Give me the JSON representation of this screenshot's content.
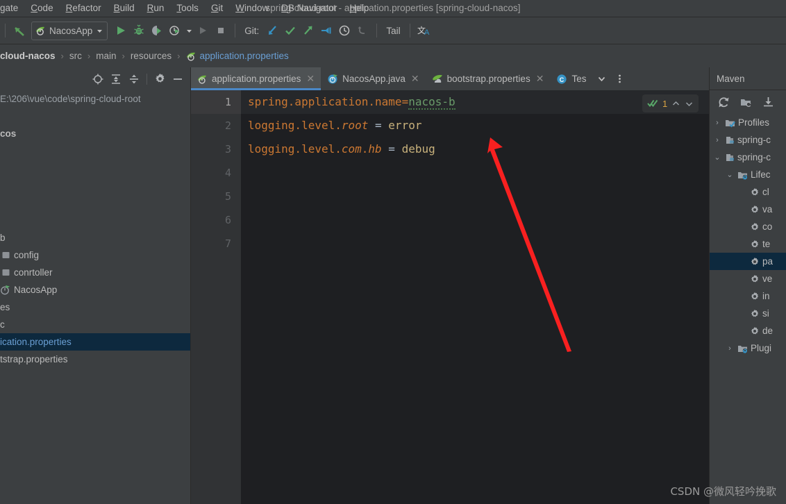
{
  "window": {
    "title": "spring-cloud-root - application.properties [spring-cloud-nacos]"
  },
  "menubar": {
    "items": [
      {
        "label": "gate"
      },
      {
        "label": "Code"
      },
      {
        "label": "Refactor"
      },
      {
        "label": "Build"
      },
      {
        "label": "Run"
      },
      {
        "label": "Tools"
      },
      {
        "label": "Git"
      },
      {
        "label": "Window"
      },
      {
        "label": "DB Navigator"
      },
      {
        "label": "Help"
      }
    ]
  },
  "toolbar": {
    "back_icon": "back-arrow-icon",
    "run_config": "NacosApp",
    "run_icon": "run-icon",
    "debug_icon": "debug-icon",
    "run_coverage_icon": "run-with-coverage-icon",
    "profile_icon": "profiler-icon",
    "rerun_icon": "rerun-icon",
    "stop_icon": "stop-icon",
    "git_label": "Git:",
    "git_update_icon": "git-update-icon",
    "git_commit_icon": "git-commit-icon",
    "git_push_icon": "git-push-icon",
    "git_branch_icon": "git-checkout-icon",
    "git_history_icon": "git-history-icon",
    "git_revert_icon": "git-revert-icon",
    "tail_label": "Tail",
    "translate_icon": "translate-icon"
  },
  "breadcrumb": {
    "items": [
      {
        "label": "cloud-nacos",
        "style": "bold"
      },
      {
        "label": "src",
        "style": "plain"
      },
      {
        "label": "main",
        "style": "plain"
      },
      {
        "label": "resources",
        "style": "plain"
      },
      {
        "label": "application.properties",
        "style": "link",
        "icon": "spring-leaf-icon"
      }
    ],
    "separator": "›"
  },
  "project_panel": {
    "header_icons": [
      "locate-icon",
      "expand-all-icon",
      "collapse-all-icon",
      "settings-gear-icon",
      "hide-icon"
    ],
    "rows": [
      {
        "label": "E:\\206\\vue\\code\\spring-cloud-root",
        "indent": 0,
        "icon": "none",
        "style": "path"
      },
      {
        "label": "",
        "indent": 0,
        "icon": "none",
        "style": "plain"
      },
      {
        "label": "cos",
        "indent": 0,
        "icon": "none",
        "style": "bold"
      },
      {
        "label": "",
        "indent": 0,
        "icon": "none",
        "style": "plain"
      },
      {
        "label": "",
        "indent": 0,
        "icon": "none",
        "style": "plain"
      },
      {
        "label": "",
        "indent": 0,
        "icon": "none",
        "style": "plain"
      },
      {
        "label": "",
        "indent": 0,
        "icon": "none",
        "style": "plain"
      },
      {
        "label": "",
        "indent": 0,
        "icon": "none",
        "style": "plain"
      },
      {
        "label": "b",
        "indent": 0,
        "icon": "none",
        "style": "plain"
      },
      {
        "label": "config",
        "indent": 0,
        "icon": "package-icon",
        "style": "plain"
      },
      {
        "label": "conrtoller",
        "indent": 0,
        "icon": "package-icon",
        "style": "plain"
      },
      {
        "label": "NacosApp",
        "indent": 0,
        "icon": "spring-class-icon",
        "style": "plain"
      },
      {
        "label": "es",
        "indent": 0,
        "icon": "none",
        "style": "plain"
      },
      {
        "label": "c",
        "indent": 0,
        "icon": "none",
        "style": "plain"
      },
      {
        "label": "ication.properties",
        "indent": 0,
        "icon": "none",
        "style": "selected"
      },
      {
        "label": "tstrap.properties",
        "indent": 0,
        "icon": "none",
        "style": "plain"
      }
    ]
  },
  "editor_tabs": {
    "tabs": [
      {
        "label": "application.properties",
        "icon": "spring-leaf-icon",
        "active": true,
        "closable": true
      },
      {
        "label": "NacosApp.java",
        "icon": "spring-boot-icon",
        "active": false,
        "closable": true
      },
      {
        "label": "bootstrap.properties",
        "icon": "spring-cloud-icon",
        "active": false,
        "closable": true
      },
      {
        "label": "Tes",
        "icon": "java-class-icon",
        "active": false,
        "closable": false
      }
    ],
    "overflow_icon": "chevron-down-icon",
    "more_icon": "more-vertical-icon"
  },
  "editor": {
    "gutter_lines": [
      "1",
      "2",
      "3",
      "4",
      "5",
      "6",
      "7"
    ],
    "current_line": 1,
    "lines": [
      {
        "n": 1,
        "tokens": [
          {
            "t": "spring.application.name",
            "c": "k"
          },
          {
            "t": "=",
            "c": "k"
          },
          {
            "t": "nacos-b",
            "c": "vg squig"
          }
        ]
      },
      {
        "n": 2,
        "tokens": [
          {
            "t": "logging.level.",
            "c": "k"
          },
          {
            "t": "root",
            "c": "ki"
          },
          {
            "t": " = ",
            "c": "eq"
          },
          {
            "t": "error",
            "c": "v"
          }
        ]
      },
      {
        "n": 3,
        "tokens": [
          {
            "t": "logging.level.",
            "c": "k"
          },
          {
            "t": "com",
            "c": "ki"
          },
          {
            "t": ".",
            "c": "k"
          },
          {
            "t": "hb",
            "c": "ki"
          },
          {
            "t": " = ",
            "c": "eq"
          },
          {
            "t": "debug",
            "c": "v"
          }
        ]
      },
      {
        "n": 4,
        "tokens": []
      },
      {
        "n": 5,
        "tokens": []
      },
      {
        "n": 6,
        "tokens": []
      },
      {
        "n": 7,
        "tokens": []
      }
    ],
    "inspection": {
      "icon": "inspections-ok-icon",
      "count": "1",
      "prev_icon": "chevron-up-icon",
      "next_icon": "chevron-down-icon"
    }
  },
  "maven_panel": {
    "title": "Maven",
    "toolbar_icons": [
      "reimport-icon",
      "generate-sources-icon",
      "download-sources-icon"
    ],
    "rows": [
      {
        "label": "Profiles",
        "indent": 0,
        "arrow": "collapsed",
        "icon": "profiles-icon",
        "selected": false
      },
      {
        "label": "spring-c",
        "indent": 0,
        "arrow": "collapsed",
        "icon": "maven-module-icon",
        "selected": false
      },
      {
        "label": "spring-c",
        "indent": 0,
        "arrow": "expanded",
        "icon": "maven-module-icon",
        "selected": false
      },
      {
        "label": "Lifec",
        "indent": 1,
        "arrow": "expanded",
        "icon": "lifecycle-icon",
        "selected": false
      },
      {
        "label": "cl",
        "indent": 2,
        "arrow": "none",
        "icon": "goal-icon",
        "selected": false
      },
      {
        "label": "va",
        "indent": 2,
        "arrow": "none",
        "icon": "goal-icon",
        "selected": false
      },
      {
        "label": "co",
        "indent": 2,
        "arrow": "none",
        "icon": "goal-icon",
        "selected": false
      },
      {
        "label": "te",
        "indent": 2,
        "arrow": "none",
        "icon": "goal-icon",
        "selected": false
      },
      {
        "label": "pa",
        "indent": 2,
        "arrow": "none",
        "icon": "goal-icon",
        "selected": true
      },
      {
        "label": "ve",
        "indent": 2,
        "arrow": "none",
        "icon": "goal-icon",
        "selected": false
      },
      {
        "label": "in",
        "indent": 2,
        "arrow": "none",
        "icon": "goal-icon",
        "selected": false
      },
      {
        "label": "si",
        "indent": 2,
        "arrow": "none",
        "icon": "goal-icon",
        "selected": false
      },
      {
        "label": "de",
        "indent": 2,
        "arrow": "none",
        "icon": "goal-icon",
        "selected": false
      },
      {
        "label": "Plugi",
        "indent": 1,
        "arrow": "collapsed",
        "icon": "plugins-icon",
        "selected": false
      }
    ]
  },
  "annotation": {
    "arrow_color": "#f82020",
    "watermark": "CSDN @微风轻吟挽歌"
  },
  "colors": {
    "bg": "#3c3f41",
    "editor_bg": "#1e1f22",
    "accent": "#4a88c7",
    "selection": "#0d293e",
    "key": "#cc7832",
    "value": "#c9b27c",
    "string_green": "#6a9c6a"
  }
}
